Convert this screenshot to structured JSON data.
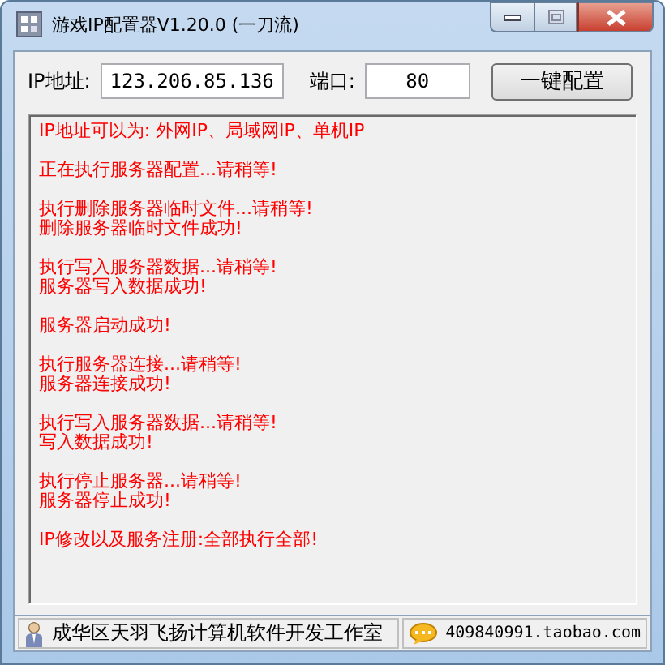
{
  "window": {
    "title": "游戏IP配置器V1.20.0 (一刀流)"
  },
  "form": {
    "ip_label": "IP地址:",
    "ip_value": "123.206.85.136",
    "port_label": "端口:",
    "port_value": "80",
    "button": "一键配置"
  },
  "log": [
    [
      "IP地址可以为: 外网IP、局域网IP、单机IP"
    ],
    [
      "正在执行服务器配置...请稍等!"
    ],
    [
      "执行删除服务器临时文件...请稍等!",
      "删除服务器临时文件成功!"
    ],
    [
      "执行写入服务器数据...请稍等!",
      "服务器写入数据成功!"
    ],
    [
      "服务器启动成功!"
    ],
    [
      "执行服务器连接...请稍等!",
      "服务器连接成功!"
    ],
    [
      "执行写入服务器数据...请稍等!",
      "写入数据成功!"
    ],
    [
      "执行停止服务器...请稍等!",
      "服务器停止成功!"
    ],
    [
      "IP修改以及服务注册:全部执行全部!"
    ]
  ],
  "status_bar": [
    {
      "kind": "person",
      "text": "成华区天羽飞扬计算机软件开发工作室"
    },
    {
      "kind": "chat",
      "text": "409840991.taobao.com"
    }
  ]
}
